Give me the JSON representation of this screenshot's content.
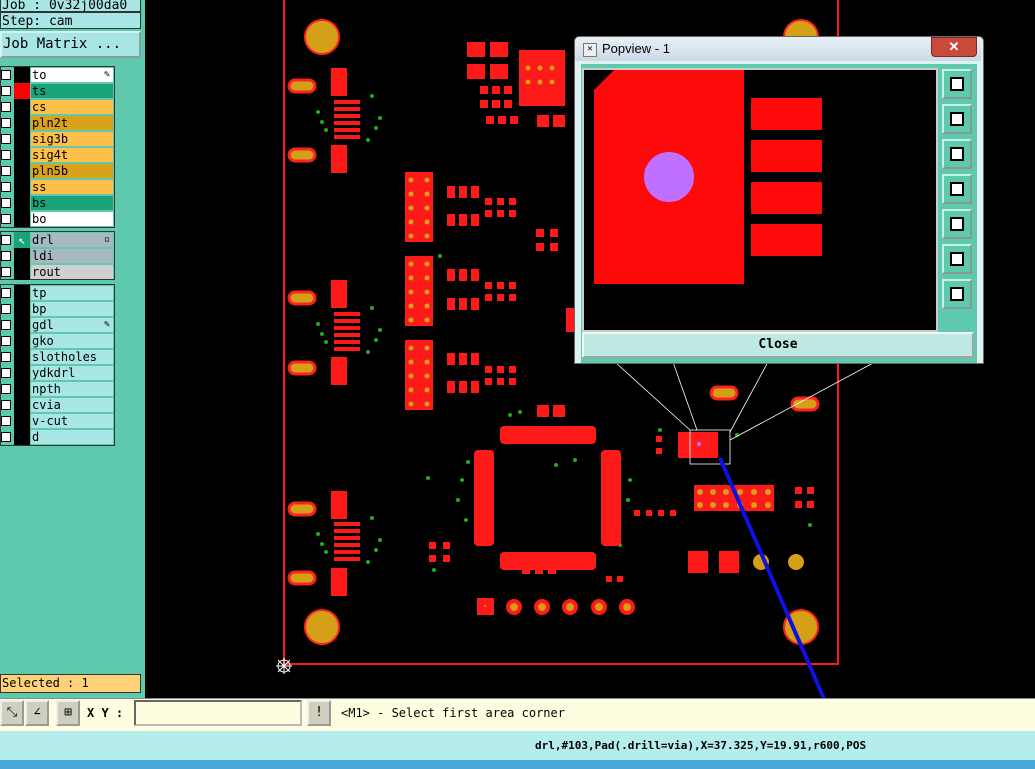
{
  "job_line": "Job : 0v32j00da0",
  "step_line": "Step: cam",
  "job_matrix_button": "Job Matrix ...",
  "layers_board": [
    {
      "name": "to",
      "color": "#ffffff",
      "swatch": "#000000",
      "extra": "✎"
    },
    {
      "name": "ts",
      "color": "#1aa37a",
      "swatch": "#ff0000",
      "extra": ""
    },
    {
      "name": "cs",
      "color": "#ffc04a",
      "swatch": "#000000",
      "extra": ""
    },
    {
      "name": "pln2t",
      "color": "#d9a21a",
      "swatch": "#000000",
      "extra": ""
    },
    {
      "name": "sig3b",
      "color": "#ffc04a",
      "swatch": "#000000",
      "extra": ""
    },
    {
      "name": "sig4t",
      "color": "#ffc04a",
      "swatch": "#000000",
      "extra": ""
    },
    {
      "name": "pln5b",
      "color": "#d9a21a",
      "swatch": "#000000",
      "extra": ""
    },
    {
      "name": "ss",
      "color": "#ffc04a",
      "swatch": "#000000",
      "extra": ""
    },
    {
      "name": "bs",
      "color": "#1aa37a",
      "swatch": "#000000",
      "extra": ""
    },
    {
      "name": "bo",
      "color": "#ffffff",
      "swatch": "#000000",
      "extra": ""
    }
  ],
  "layers_drill": [
    {
      "name": "drl",
      "color": "#a8b8c0",
      "swatch": "#1aa37a",
      "extra": "▫"
    },
    {
      "name": "ldi",
      "color": "#a8b8c0",
      "swatch": "#000000",
      "extra": ""
    },
    {
      "name": "rout",
      "color": "#d0d0d0",
      "swatch": "#000000",
      "extra": ""
    }
  ],
  "layers_misc": [
    {
      "name": "tp",
      "color": "#a8e6e6",
      "swatch": "#000000",
      "extra": ""
    },
    {
      "name": "bp",
      "color": "#a8e6e6",
      "swatch": "#000000",
      "extra": ""
    },
    {
      "name": "gdl",
      "color": "#a8e6e6",
      "swatch": "#000000",
      "extra": "✎"
    },
    {
      "name": "gko",
      "color": "#a8e6e6",
      "swatch": "#000000",
      "extra": ""
    },
    {
      "name": "slotholes",
      "color": "#a8e6e6",
      "swatch": "#000000",
      "extra": ""
    },
    {
      "name": "ydkdrl",
      "color": "#a8e6e6",
      "swatch": "#000000",
      "extra": ""
    },
    {
      "name": "npth",
      "color": "#a8e6e6",
      "swatch": "#000000",
      "extra": ""
    },
    {
      "name": "cvia",
      "color": "#a8e6e6",
      "swatch": "#000000",
      "extra": ""
    },
    {
      "name": "v-cut",
      "color": "#a8e6e6",
      "swatch": "#000000",
      "extra": ""
    },
    {
      "name": "d",
      "color": "#a8e6e6",
      "swatch": "#000000",
      "extra": ""
    }
  ],
  "selected": "Selected : 1",
  "xy_label": "X Y :",
  "xy_value": "",
  "prompt": "<M1> - Select first area corner",
  "status": "drl,#103,Pad(.drill=via),X=37.325,Y=19.91,r600,POS",
  "popup": {
    "title": "Popview - 1",
    "close_button": "Close",
    "close_x": "✕"
  }
}
